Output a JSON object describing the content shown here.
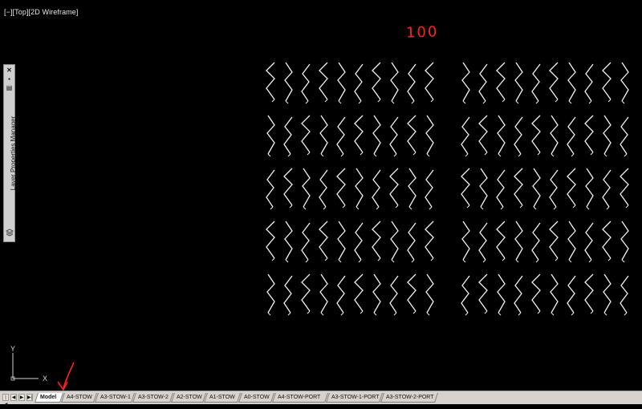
{
  "viewport": {
    "view_label": "[−][Top][2D Wireframe]",
    "annotation": "100",
    "annotation_color": "#ff2020"
  },
  "palette": {
    "title": "Layer Properties Manager",
    "close_icon": "close-icon",
    "autohide_icon": "autohide-icon",
    "properties_icon": "properties-icon"
  },
  "ucs": {
    "x_label": "X",
    "y_label": "Y"
  },
  "tabbar": {
    "nav_icons": [
      "first-tab-icon",
      "prev-tab-icon",
      "next-tab-icon",
      "last-tab-icon"
    ],
    "tabs": [
      {
        "label": "Model",
        "active": true
      },
      {
        "label": "A4-STOW",
        "active": false
      },
      {
        "label": "A3-STOW-1",
        "active": false
      },
      {
        "label": "A3-STOW-2",
        "active": false
      },
      {
        "label": "A2-STOW",
        "active": false
      },
      {
        "label": "A1-STOW",
        "active": false
      },
      {
        "label": "A0-STOW",
        "active": false
      },
      {
        "label": "A4-STOW-PORT",
        "active": false
      },
      {
        "label": "A3-STOW-1-PORT",
        "active": false
      },
      {
        "label": "A3-STOW-2-PORT",
        "active": false
      }
    ]
  },
  "drawing": {
    "groups": 2,
    "rows": 5,
    "columns_per_group": 10,
    "stroke_color": "#f2f2f2",
    "arrow_color": "#ff2020"
  }
}
